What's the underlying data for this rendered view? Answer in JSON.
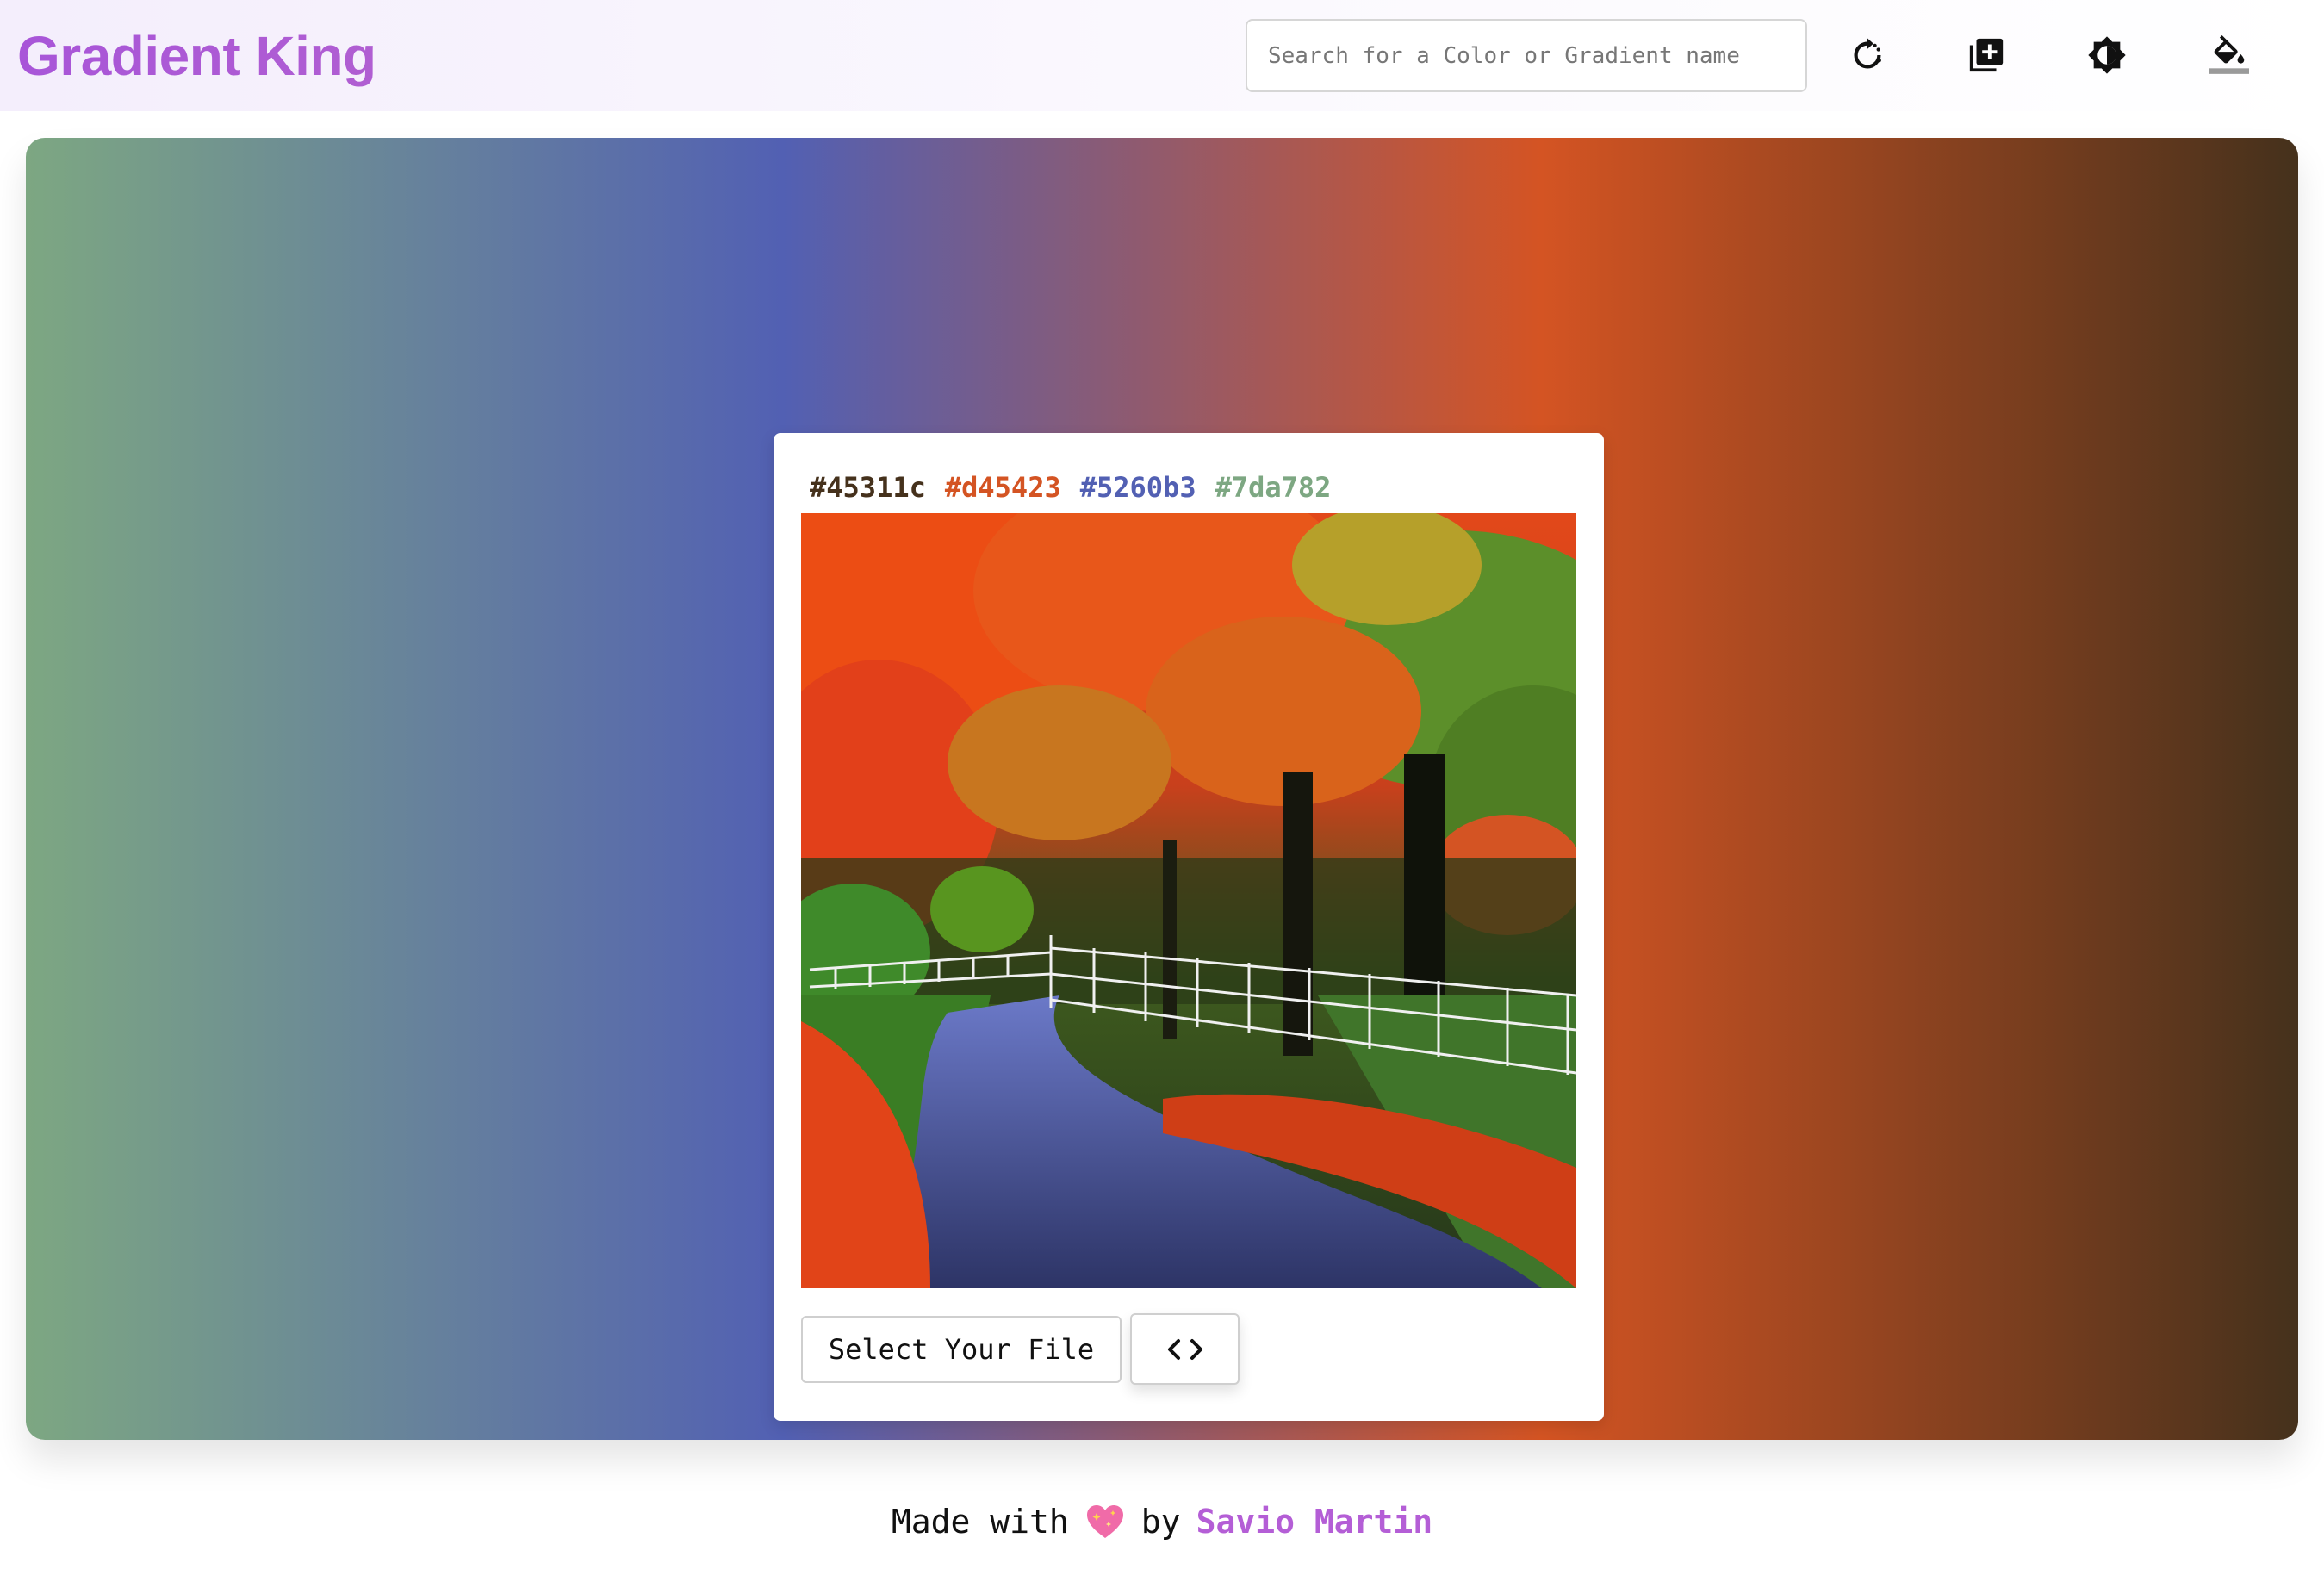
{
  "header": {
    "brand": "Gradient King",
    "search_placeholder": "Search for a Color or Gradient name",
    "icons": [
      "refresh-icon",
      "add-box-icon",
      "brightness-icon",
      "paint-bucket-icon"
    ]
  },
  "gradient": {
    "direction": "to right",
    "colors": [
      "#7da782",
      "#5260b3",
      "#d45423",
      "#45311c"
    ]
  },
  "card": {
    "hex_codes": [
      {
        "label": "#45311c",
        "color": "#45311c"
      },
      {
        "label": "#d45423",
        "color": "#d45423"
      },
      {
        "label": "#5260b3",
        "color": "#5260b3"
      },
      {
        "label": "#7da782",
        "color": "#7da782"
      }
    ],
    "image_alt": "autumn-road-photo",
    "select_file_label": "Select Your File",
    "code_icon": "code-icon"
  },
  "footer": {
    "made_with": "Made with",
    "heart_icon": "sparkling-heart-icon",
    "by": "by",
    "author": "Savio Martin"
  }
}
